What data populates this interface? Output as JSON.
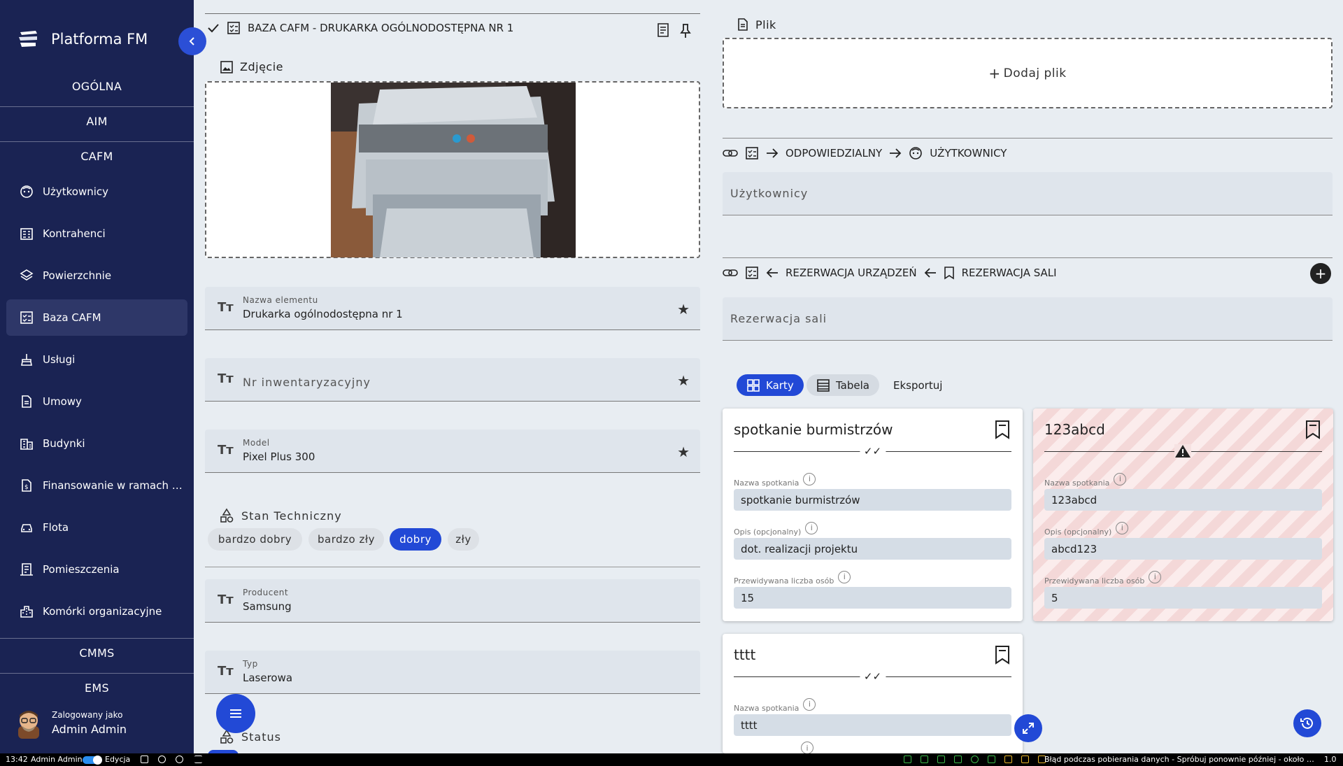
{
  "app": {
    "title": "Platforma FM"
  },
  "sidebar": {
    "sections": {
      "ogolna": "OGÓLNA",
      "aim": "AIM",
      "cafm": "CAFM",
      "cmms": "CMMS",
      "ems": "EMS"
    },
    "items": [
      {
        "label": "Użytkownicy",
        "icon": "users-icon"
      },
      {
        "label": "Kontrahenci",
        "icon": "building-card-icon"
      },
      {
        "label": "Powierzchnie",
        "icon": "layers-icon"
      },
      {
        "label": "Baza CAFM",
        "icon": "checklist-icon",
        "active": true
      },
      {
        "label": "Usługi",
        "icon": "broom-icon"
      },
      {
        "label": "Umowy",
        "icon": "document-icon"
      },
      {
        "label": "Budynki",
        "icon": "buildings-icon"
      },
      {
        "label": "Finansowanie w ramach p...",
        "icon": "finance-document-icon"
      },
      {
        "label": "Flota",
        "icon": "car-icon"
      },
      {
        "label": "Pomieszczenia",
        "icon": "room-icon"
      },
      {
        "label": "Komórki organizacyjne",
        "icon": "organization-icon"
      }
    ],
    "user": {
      "logged_as": "Zalogowany jako",
      "name": "Admin Admin"
    }
  },
  "record": {
    "header": "BAZA CAFM - DRUKARKA OGÓLNODOSTĘPNA NR 1",
    "photo_label": "Zdjęcie",
    "fields": {
      "name": {
        "label": "Nazwa elementu",
        "value": "Drukarka ogólnodostępna nr 1"
      },
      "inventory": {
        "placeholder": "Nr inwentaryzacyjny"
      },
      "model": {
        "label": "Model",
        "value": "Pixel Plus 300"
      },
      "producer": {
        "label": "Producent",
        "value": "Samsung"
      },
      "type": {
        "label": "Typ",
        "value": "Laserowa"
      }
    },
    "tech_state": {
      "label": "Stan Techniczny",
      "options": [
        "bardzo dobry",
        "bardzo zły",
        "dobry",
        "zły"
      ],
      "selected": "dobry"
    },
    "status_label": "Status"
  },
  "right": {
    "file_label": "Plik",
    "add_file": "Dodaj plik",
    "rel1": {
      "a": "ODPOWIEDZIALNY",
      "b": "UŻYTKOWNICY",
      "field": "Użytkownicy"
    },
    "rel2": {
      "a": "REZERWACJA URZĄDZEŃ",
      "b": "REZERWACJA SALI",
      "field": "Rezerwacja sali"
    },
    "view_tabs": {
      "cards": "Karty",
      "table": "Tabela",
      "export": "Eksportuj"
    },
    "cards": [
      {
        "title": "spotkanie burmistrzów",
        "status": "ok",
        "name_label": "Nazwa spotkania",
        "name": "spotkanie burmistrzów",
        "desc_label": "Opis (opcjonalny)",
        "desc": "dot. realizacji projektu",
        "count_label": "Przewidywana liczba osób",
        "count": "15"
      },
      {
        "title": "123abcd",
        "status": "warning",
        "name_label": "Nazwa spotkania",
        "name": "123abcd",
        "desc_label": "Opis (opcjonalny)",
        "desc": "abcd123",
        "count_label": "Przewidywana liczba osób",
        "count": "5"
      },
      {
        "title": "tttt",
        "status": "ok",
        "name_label": "Nazwa spotkania",
        "name": "tttt"
      }
    ]
  },
  "statusbar": {
    "time": "13:42",
    "user": "Admin Admin",
    "mode": "Edycja",
    "error": "Błąd podczas pobierania danych - Spróbuj ponownie później - około godziny temu",
    "version": "1.0"
  },
  "colors": {
    "sidebar_bg": "#1a2353",
    "accent": "#2249d6",
    "background": "#e8edf2"
  }
}
